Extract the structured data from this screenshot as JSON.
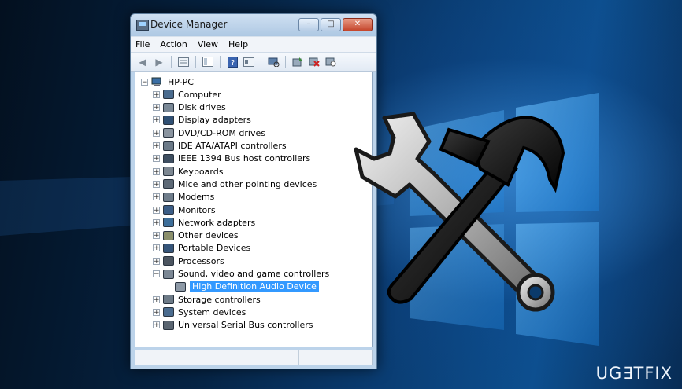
{
  "window": {
    "title": "Device Manager",
    "controls": {
      "minimize": "–",
      "maximize": "□",
      "close": "✕"
    }
  },
  "menu": [
    "File",
    "Action",
    "View",
    "Help"
  ],
  "toolbar_icons": [
    "back-arrow-icon",
    "forward-arrow-icon",
    "properties-icon",
    "console-tree-icon",
    "help-icon",
    "view-icon",
    "scan-hardware-icon",
    "update-driver-icon",
    "uninstall-icon",
    "disable-icon"
  ],
  "tree": {
    "root": "HP-PC",
    "items": [
      {
        "label": "Computer",
        "icon": "computer-icon",
        "expanded": false,
        "color": "#4a6b8e"
      },
      {
        "label": "Disk drives",
        "icon": "disk-drive-icon",
        "expanded": false,
        "color": "#7a8896"
      },
      {
        "label": "Display adapters",
        "icon": "display-adapter-icon",
        "expanded": false,
        "color": "#2f4f73"
      },
      {
        "label": "DVD/CD-ROM drives",
        "icon": "dvd-drive-icon",
        "expanded": false,
        "color": "#8a949f"
      },
      {
        "label": "IDE ATA/ATAPI controllers",
        "icon": "ide-controller-icon",
        "expanded": false,
        "color": "#6c7a88"
      },
      {
        "label": "IEEE 1394 Bus host controllers",
        "icon": "ieee1394-icon",
        "expanded": false,
        "color": "#3e4e60"
      },
      {
        "label": "Keyboards",
        "icon": "keyboard-icon",
        "expanded": false,
        "color": "#7d8791"
      },
      {
        "label": "Mice and other pointing devices",
        "icon": "mouse-icon",
        "expanded": false,
        "color": "#5d6976"
      },
      {
        "label": "Modems",
        "icon": "modem-icon",
        "expanded": false,
        "color": "#6f7d8b"
      },
      {
        "label": "Monitors",
        "icon": "monitor-icon",
        "expanded": false,
        "color": "#3b5d86"
      },
      {
        "label": "Network adapters",
        "icon": "network-adapter-icon",
        "expanded": false,
        "color": "#3d6e99"
      },
      {
        "label": "Other devices",
        "icon": "other-devices-icon",
        "expanded": false,
        "color": "#8b8f6b"
      },
      {
        "label": "Portable Devices",
        "icon": "portable-device-icon",
        "expanded": false,
        "color": "#36557a"
      },
      {
        "label": "Processors",
        "icon": "processor-icon",
        "expanded": false,
        "color": "#4c5560"
      },
      {
        "label": "Sound, video and game controllers",
        "icon": "speaker-icon",
        "expanded": true,
        "color": "#7b8794",
        "children": [
          {
            "label": "High Definition Audio Device",
            "icon": "speaker-icon",
            "selected": true
          }
        ]
      },
      {
        "label": "Storage controllers",
        "icon": "storage-controller-icon",
        "expanded": false,
        "color": "#6d7a87"
      },
      {
        "label": "System devices",
        "icon": "system-devices-icon",
        "expanded": false,
        "color": "#4a6b8e"
      },
      {
        "label": "Universal Serial Bus controllers",
        "icon": "usb-icon",
        "expanded": false,
        "color": "#5a6571"
      }
    ]
  },
  "brand": "UG∃TFIX",
  "colors": {
    "selection": "#3399ff",
    "titlebar": "#bcd3ea",
    "close": "#c4442a"
  }
}
